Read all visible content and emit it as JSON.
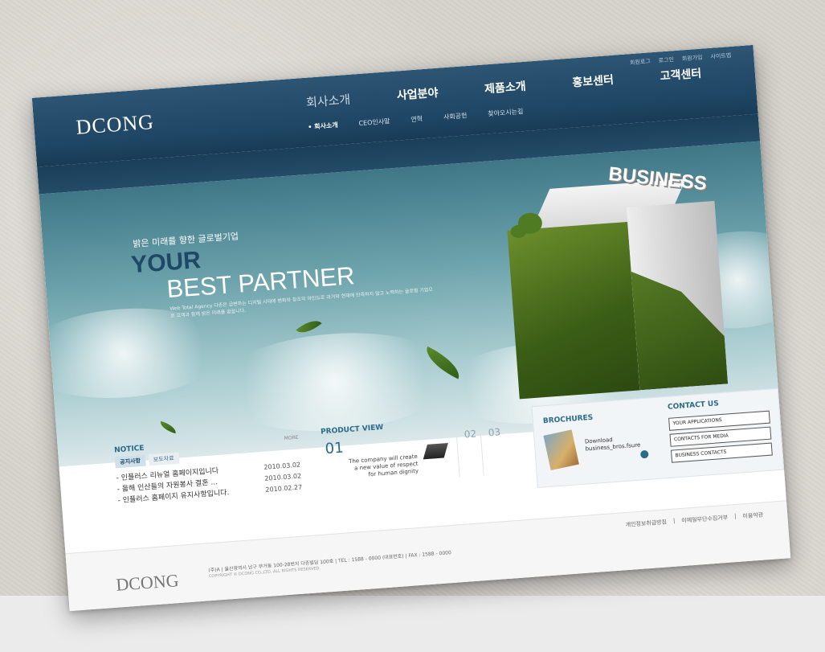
{
  "brand": {
    "logo": "DCONG"
  },
  "util_links": [
    "회원로그",
    "로그인",
    "회원가입",
    "사이트맵"
  ],
  "main_nav": [
    "회사소개",
    "사업분야",
    "제품소개",
    "홍보센터",
    "고객센터"
  ],
  "sub_nav": [
    "• 회사소개",
    "CEO인사말",
    "연혁",
    "사회공헌",
    "찾아오시는길"
  ],
  "hero": {
    "tagline": "밝은 미래를 향한 글로벌기업",
    "headline_1": "YOUR",
    "headline_2": "BEST PARTNER",
    "description": "Web Total Agency 다존은 급변하는 디지털 시대에 변화와 창조의 마인드로 과거와 현재에 만족하지 않고 노력하는 글로벌 기업으로 고객과 함께 밝은 미래를 꿈꿉니다.",
    "cube_word": "BUSINESS"
  },
  "notice": {
    "title": "NOTICE",
    "tabs": [
      "공지사항",
      "보도자료"
    ],
    "more": "MORE",
    "items": [
      {
        "text": "- 인플러스 리뉴얼 홈페이지입니다",
        "date": "2010.03.02"
      },
      {
        "text": "- 올해 인산들의 자원봉사 결혼 ...",
        "date": "2010.03.02"
      },
      {
        "text": "- 인플러스 홈페이지 유지사항입니다.",
        "date": "2010.02.27"
      }
    ]
  },
  "product": {
    "title": "PRODUCT VIEW",
    "number": "01",
    "text": "The company will create a new value of respect for human dignity",
    "pages": [
      "02",
      "03"
    ]
  },
  "brochures": {
    "title": "BROCHURES",
    "download_label": "Download",
    "download_file": "business_bros.fsure"
  },
  "contact": {
    "title": "CONTACT US",
    "links": [
      "YOUR APPLICATIONS",
      "CONTACTS FOR MEDIA",
      "BUSINESS CONTACTS"
    ]
  },
  "footer": {
    "logo": "DCONG",
    "address": "(주)A | 울산광역시 남구 무거동 100-28번지 다존빌딩 100호 | TEL : 1588 - 0000 (대표번호) | FAX : 1588 - 0000",
    "copyright": "COPYRIGHT © DCONG CO.,LTD. ALL RIGHTS RESERVED.",
    "links": [
      "개인정보취급방침",
      "이메일무단수집거부",
      "이용약관"
    ]
  }
}
